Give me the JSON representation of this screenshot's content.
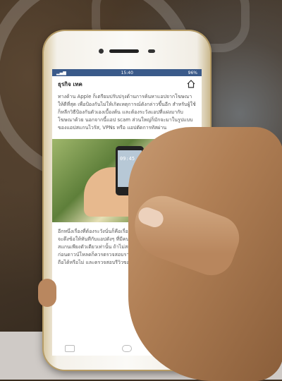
{
  "status": {
    "time": "15:40",
    "battery": "96%"
  },
  "app": {
    "title": "ธุรกิจ เทค"
  },
  "article": {
    "paragraph_1": "ทางด้าน Apple ก็เตรียมปรับปรุงด้านการค้นหาแอปจากโฆษณาให้ดีที่สุด เพื่อป้องกันไม่ให้เกิดเหตุการณ์ดังกล่าวขึ้นอีก สำหรับผู้ใช้ก็หลีกวิธีป้องกันตัวเองเบื้องต้น และต้องระวังแอปที่แฝงมากับโฆษณาด้วย นอกจากนี้แอป scam ส่วนใหญ่ก็มักจะมาในรูปแบบของแอปสแกนไวรัส, VPNs หรือ แอปตัดการทัสผ่าน",
    "paragraph_2": "อีกหนึ่งเรื่องที่ต้องระวังนั่นก็คือเรื่อง... นั่นเอง เพราะแอป scam จะดึงข้อให้ทันทีกับแอปดังๆ ที่มีคนใช้งานแอปๆ ซึ่งจะทำการตั้งสแกนเพียงตัวเดียวเท่านั้น ถ้าไม่สแกนก็จะแอปก ไม่ออกเลย ดังนั้นก่อนดาวน์โหลดก็ควรตรวจสอบรายละเอียดก่อนว่าผู้พัฒนานั้นชื่อถือได้หรือไม่ และดรวจสอบรีวิวของผู้ที่ดาวน์โหลด",
    "photo_clock": "09:45"
  },
  "icons": {
    "home": "home-icon"
  },
  "colors": {
    "statusbar": "#3a5a8a"
  }
}
